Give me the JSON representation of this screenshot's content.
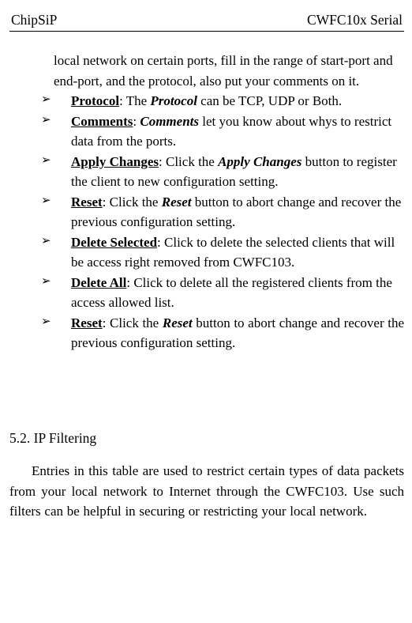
{
  "header": {
    "left": "ChipSiP",
    "right": "CWFC10x Serial"
  },
  "intro": "local network on certain ports, fill in the range of start-port and end-port, and the protocol, also put your comments on it.",
  "items": [
    {
      "label": "Protocol",
      "colonText": ": The ",
      "emph": "Protocol",
      "tail": " can be TCP, UDP or Both.",
      "justify": false
    },
    {
      "label": "Comments",
      "colonText": ": ",
      "emph": "Comments",
      "tail": " let you know about whys to restrict data from the ports.",
      "justify": false
    },
    {
      "label": "Apply Changes",
      "colonText": ": Click the ",
      "emph": "Apply Changes",
      "tail": " button to register the client to new configuration setting.",
      "justify": false
    },
    {
      "label": "Reset",
      "colonText": ": Click the ",
      "emph": "Reset",
      "tail": " button to abort change and recover the previous configuration setting.",
      "justify": false
    },
    {
      "label": "Delete Selected",
      "colonText": ": Click to delete the selected clients that will be access right removed from CWFC103.",
      "emph": "",
      "tail": "",
      "justify": false
    },
    {
      "label": "Delete All",
      "colonText": ": Click to delete all the registered clients from the access allowed list.",
      "emph": "",
      "tail": "",
      "justify": false
    },
    {
      "label": "Reset",
      "colonText": ": Click the ",
      "emph": "Reset",
      "tail": " button to abort change and recover the previous configuration setting.",
      "justify": true
    }
  ],
  "section": {
    "heading": "5.2. IP Filtering",
    "body": "Entries in this table are used to restrict certain types of data packets from your local network to Internet through the CWFC103.  Use such filters can be helpful in securing or restricting your local network."
  }
}
